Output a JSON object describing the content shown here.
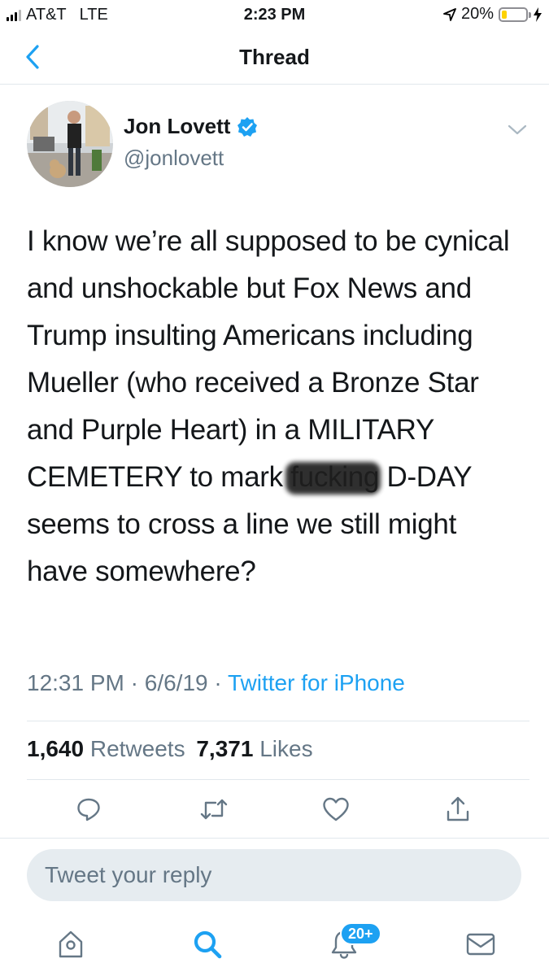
{
  "status_bar": {
    "carrier": "AT&T",
    "network": "LTE",
    "time": "2:23 PM",
    "battery": "20%",
    "battery_level": 0.2,
    "battery_color": "#fdd200",
    "icons": [
      "signal-icon",
      "location-arrow-icon",
      "battery-icon",
      "charging-bolt-icon"
    ]
  },
  "nav": {
    "title": "Thread",
    "back_icon": "chevron-left-icon"
  },
  "tweet": {
    "author_name": "Jon Lovett",
    "author_handle": "@jonlovett",
    "verified": true,
    "text_before": "I know we’re all supposed to be cynical and unshockable but Fox News and Trump insulting Americans including Mueller (who received a Bronze Star and Purple Heart) in a MILITARY CEMETERY to mark ",
    "text_redacted": "fucking",
    "text_after": " D-DAY seems to cross a line we still might have somewhere?",
    "time": "12:31 PM",
    "date": "6/6/19",
    "separator": "·",
    "source": "Twitter for iPhone",
    "retweets_count": "1,640",
    "retweets_label": "Retweets",
    "likes_count": "7,371",
    "likes_label": "Likes"
  },
  "actions": [
    "reply-icon",
    "retweet-icon",
    "like-icon",
    "share-icon"
  ],
  "reply": {
    "placeholder": "Tweet your reply"
  },
  "tab_bar": {
    "tabs": [
      "home-icon",
      "search-icon",
      "notifications-icon",
      "messages-icon"
    ],
    "notifications_badge": "20+",
    "active_tab": "search"
  },
  "colors": {
    "accent": "#1da1f2",
    "secondary_text": "#657786",
    "primary_text": "#14171a",
    "divider": "#e1e8ed"
  }
}
